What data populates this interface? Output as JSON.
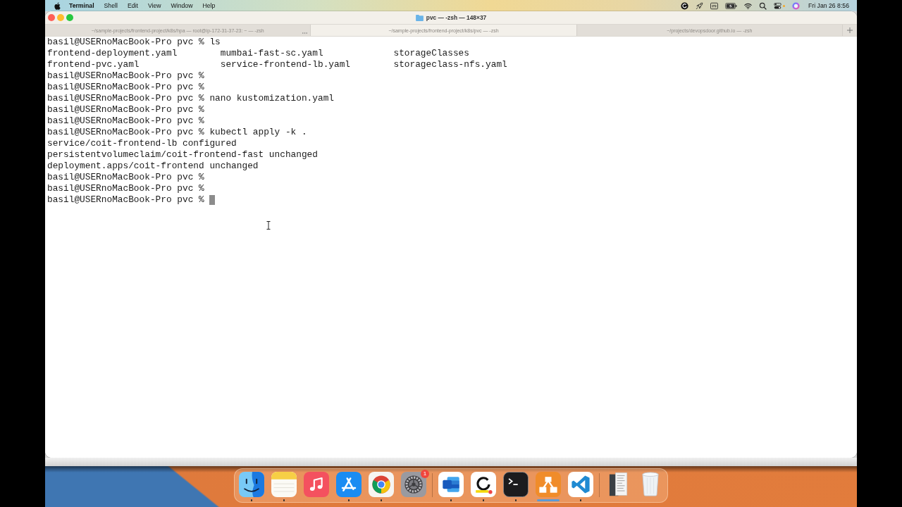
{
  "menu_bar": {
    "menus": [
      {
        "label": "Terminal",
        "kind": "app"
      },
      {
        "label": "Shell",
        "kind": "menu"
      },
      {
        "label": "Edit",
        "kind": "menu"
      },
      {
        "label": "View",
        "kind": "menu"
      },
      {
        "label": "Window",
        "kind": "menu"
      },
      {
        "label": "Help",
        "kind": "menu"
      }
    ],
    "clock": "Fri Jan 26 8:56"
  },
  "window": {
    "title": "pvc — -zsh — 148×37"
  },
  "tabs": [
    {
      "title": "~/sample-projects/frontend-project/k8s/hpa — root@ip-172-31-37-23: ~ — -zsh",
      "selected": false,
      "activity": true
    },
    {
      "title": "~/sample-projects/frontend-project/k8s/pvc — -zsh",
      "selected": true,
      "activity": false
    },
    {
      "title": "~/projects/devopsdoor.github.io — -zsh",
      "selected": false,
      "activity": false
    }
  ],
  "terminal": {
    "lines": [
      {
        "kind": "prompt",
        "text": "basil@USERnoMacBook-Pro pvc % ls",
        "cursor": false
      },
      {
        "kind": "columns",
        "cells": [
          "frontend-deployment.yaml",
          "mumbai-fast-sc.yaml",
          "storageClasses"
        ]
      },
      {
        "kind": "columns",
        "cells": [
          "frontend-pvc.yaml",
          "service-frontend-lb.yaml",
          "storageclass-nfs.yaml"
        ]
      },
      {
        "kind": "prompt",
        "text": "basil@USERnoMacBook-Pro pvc %",
        "cursor": false
      },
      {
        "kind": "prompt",
        "text": "basil@USERnoMacBook-Pro pvc %",
        "cursor": false
      },
      {
        "kind": "prompt",
        "text": "basil@USERnoMacBook-Pro pvc % nano kustomization.yaml",
        "cursor": false
      },
      {
        "kind": "prompt",
        "text": "basil@USERnoMacBook-Pro pvc %",
        "cursor": false
      },
      {
        "kind": "prompt",
        "text": "basil@USERnoMacBook-Pro pvc %",
        "cursor": false
      },
      {
        "kind": "prompt",
        "text": "basil@USERnoMacBook-Pro pvc % kubectl apply -k .",
        "cursor": false
      },
      {
        "kind": "output",
        "text": "service/coit-frontend-lb configured"
      },
      {
        "kind": "output",
        "text": "persistentvolumeclaim/coit-frontend-fast unchanged"
      },
      {
        "kind": "output",
        "text": "deployment.apps/coit-frontend unchanged"
      },
      {
        "kind": "prompt",
        "text": "basil@USERnoMacBook-Pro pvc %",
        "cursor": false
      },
      {
        "kind": "prompt",
        "text": "basil@USERnoMacBook-Pro pvc %",
        "cursor": false
      },
      {
        "kind": "prompt",
        "text": "basil@USERnoMacBook-Pro pvc %",
        "cursor": true
      }
    ]
  },
  "dock": {
    "groups": [
      [
        {
          "running": true,
          "highlighted": false
        },
        {
          "running": true,
          "highlighted": false
        },
        {
          "running": false,
          "highlighted": false
        },
        {
          "running": true,
          "highlighted": false
        },
        {
          "running": true,
          "highlighted": false
        },
        {
          "running": false,
          "highlighted": false,
          "badge": "1"
        }
      ],
      [
        {
          "running": true,
          "highlighted": false
        },
        {
          "running": true,
          "highlighted": false
        },
        {
          "running": true,
          "highlighted": false
        },
        {
          "running": false,
          "highlighted": true
        },
        {
          "running": true,
          "highlighted": false
        }
      ],
      [
        {
          "running": false,
          "highlighted": false
        },
        {
          "running": false,
          "highlighted": false
        }
      ]
    ]
  }
}
